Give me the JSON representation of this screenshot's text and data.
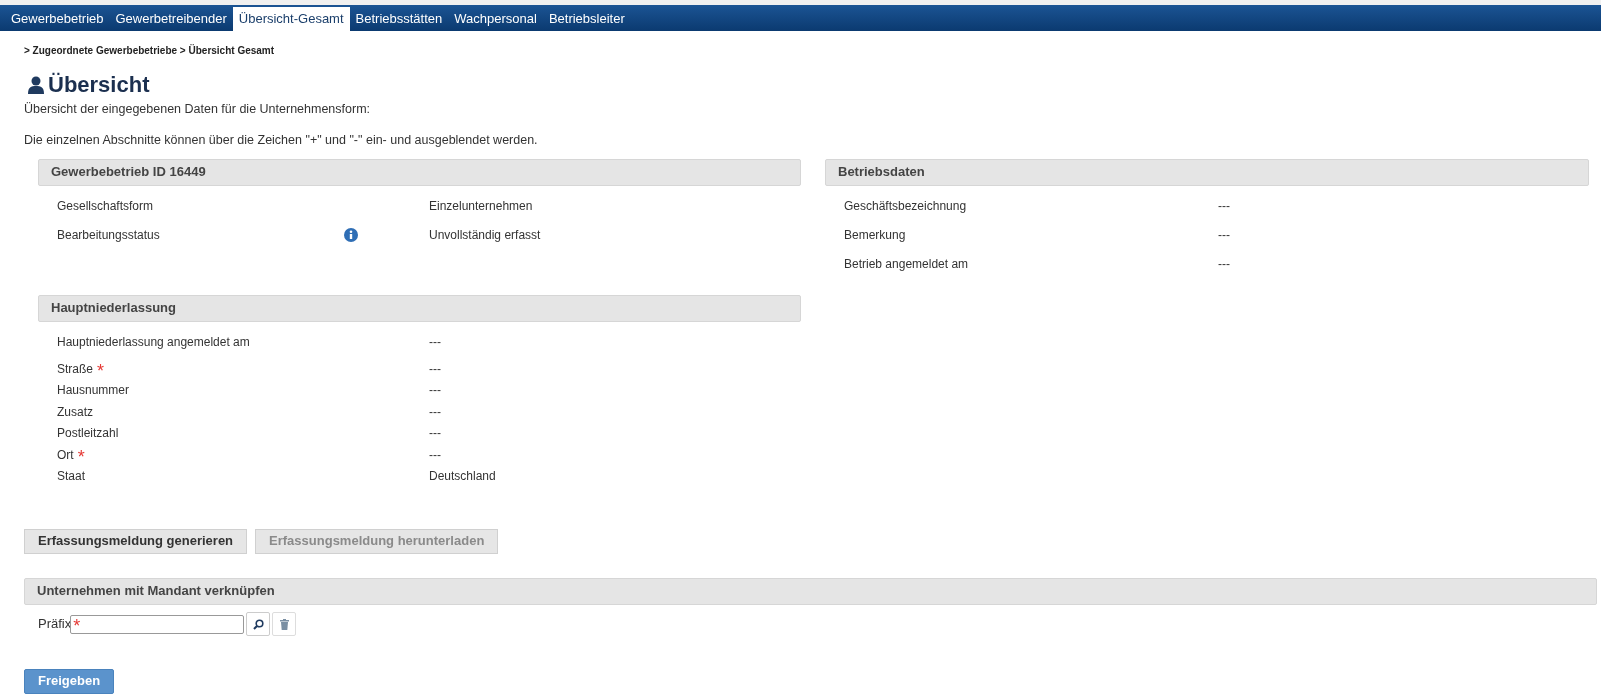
{
  "tabs": [
    {
      "label": "Gewerbebetrieb",
      "selected": false
    },
    {
      "label": "Gewerbetreibender",
      "selected": false
    },
    {
      "label": "Übersicht-Gesamt",
      "selected": true
    },
    {
      "label": "Betriebsstätten",
      "selected": false
    },
    {
      "label": "Wachpersonal",
      "selected": false
    },
    {
      "label": "Betriebsleiter",
      "selected": false
    }
  ],
  "breadcrumb": "> Zugeordnete Gewerbebetriebe > Übersicht Gesamt",
  "title": "Übersicht",
  "intro": [
    "Übersicht der eingegebenen Daten für die Unternehmensform:",
    "Die einzelnen Abschnitte können über die Zeichen \"+\" und \"-\" ein- und ausgeblendet werden."
  ],
  "left_sections": [
    {
      "title": "Gewerbebetrieb ID 16449",
      "rows": [
        {
          "label": "Gesellschaftsform",
          "value": "Einzelunternehmen",
          "info": false,
          "spacious": true
        },
        {
          "label": "Bearbeitungsstatus",
          "value": "Unvollständig erfasst",
          "info": true,
          "spacious": true
        }
      ]
    },
    {
      "title": "Hauptniederlassung",
      "rows": [
        {
          "label": "Hauptniederlassung angemeldet am",
          "value": "---",
          "spacious": true
        },
        {
          "label": "Straße",
          "required_mark": "*",
          "value": "---",
          "spacious": false
        },
        {
          "label": "Hausnummer",
          "value": "---",
          "spacious": false
        },
        {
          "label": "Zusatz",
          "value": "---",
          "spacious": false
        },
        {
          "label": "Postleitzahl",
          "value": "---",
          "spacious": false
        },
        {
          "label": "Ort",
          "required_mark": "*",
          "value": "---",
          "spacious": false
        },
        {
          "label": "Staat",
          "value": "Deutschland",
          "spacious": false
        }
      ]
    }
  ],
  "right_section": {
    "title": "Betriebsdaten",
    "rows": [
      {
        "label": "Geschäftsbezeichnung",
        "value": "---",
        "spacious": true
      },
      {
        "label": "Bemerkung",
        "value": "---",
        "spacious": true
      },
      {
        "label": "Betrieb angemeldet am",
        "value": "---",
        "spacious": true
      }
    ]
  },
  "actions": [
    {
      "label": "Erfassungsmeldung generieren",
      "disabled": false
    },
    {
      "label": "Erfassungsmeldung herunterladen",
      "disabled": true
    }
  ],
  "link_section": {
    "title": "Unternehmen mit Mandant verknüpfen",
    "field_label": "Präfix",
    "required_mark": "*"
  },
  "submit": "Freigeben"
}
